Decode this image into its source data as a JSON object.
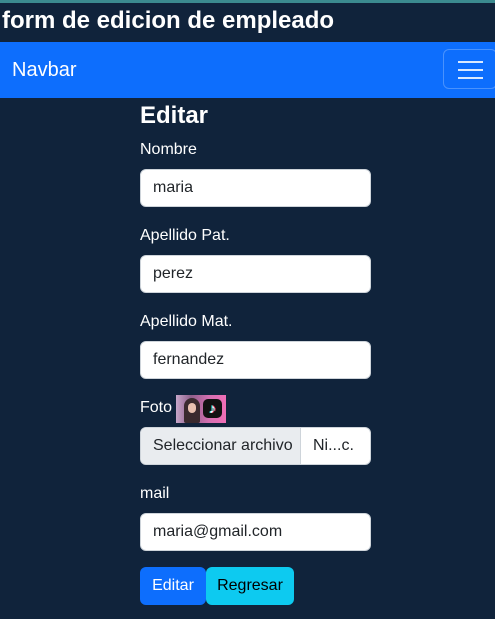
{
  "page": {
    "heading": "form de edicion de empleado"
  },
  "navbar": {
    "brand": "Navbar",
    "toggle_icon": "hamburger-menu-icon"
  },
  "form": {
    "title": "Editar",
    "nombre": {
      "label": "Nombre",
      "value": "maria"
    },
    "apellido_pat": {
      "label": "Apellido Pat.",
      "value": "perez"
    },
    "apellido_mat": {
      "label": "Apellido Mat.",
      "value": "fernandez"
    },
    "foto": {
      "label": "Foto",
      "file_button": "Seleccionar archivo",
      "file_name": "Ni...c."
    },
    "mail": {
      "label": "mail",
      "value": "maria@gmail.com"
    },
    "submit_label": "Editar",
    "back_label": "Regresar"
  },
  "colors": {
    "background": "#10233b",
    "navbar": "#0d6efd",
    "primary": "#0d6efd",
    "info": "#0dcaf0"
  }
}
